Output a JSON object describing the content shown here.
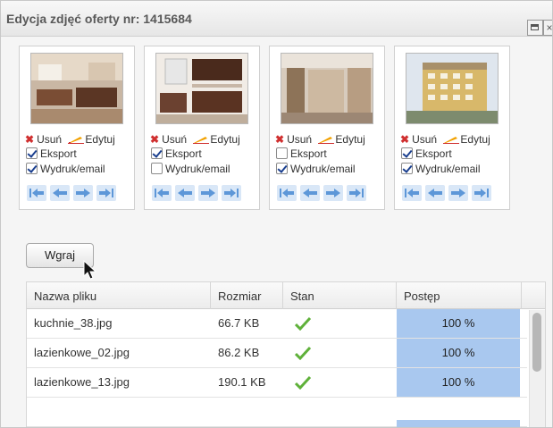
{
  "dialog": {
    "title": "Edycja zdjęć oferty nr: 1415684",
    "maximize_icon": "maximize-icon",
    "close_icon": "close-icon"
  },
  "photos": [
    {
      "delete_label": "Usuń",
      "edit_label": "Edytuj",
      "export_label": "Eksport",
      "print_label": "Wydruk/email",
      "export_checked": true,
      "print_checked": true
    },
    {
      "delete_label": "Usuń",
      "edit_label": "Edytuj",
      "export_label": "Eksport",
      "print_label": "Wydruk/email",
      "export_checked": true,
      "print_checked": false
    },
    {
      "delete_label": "Usuń",
      "edit_label": "Edytuj",
      "export_label": "Eksport",
      "print_label": "Wydruk/email",
      "export_checked": false,
      "print_checked": true
    },
    {
      "delete_label": "Usuń",
      "edit_label": "Edytuj",
      "export_label": "Eksport",
      "print_label": "Wydruk/email",
      "export_checked": true,
      "print_checked": true
    }
  ],
  "upload": {
    "button_label": "Wgraj"
  },
  "table": {
    "headers": [
      "Nazwa pliku",
      "Rozmiar",
      "Stan",
      "Postęp"
    ],
    "rows": [
      {
        "name": "kuchnie_38.jpg",
        "size": "66.7 KB",
        "progress": "100 %"
      },
      {
        "name": "lazienkowe_02.jpg",
        "size": "86.2 KB",
        "progress": "100 %"
      },
      {
        "name": "lazienkowe_13.jpg",
        "size": "190.1 KB",
        "progress": "100 %"
      }
    ]
  },
  "colors": {
    "progress": "#a9c8ef",
    "check_ok": "#5fb13a",
    "nav_arrows": "#7fb0e6",
    "delete": "#d03030"
  }
}
